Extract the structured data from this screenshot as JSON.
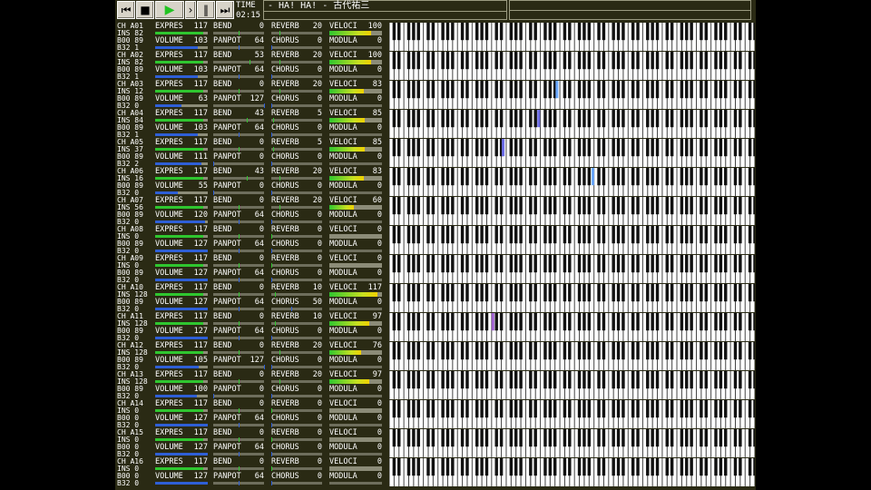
{
  "toolbar": {
    "buttons": [
      {
        "name": "rewind-to-start-button",
        "glyph": "⏮"
      },
      {
        "name": "stop-button",
        "glyph": "■"
      },
      {
        "name": "play-button",
        "glyph": "▶"
      },
      {
        "name": "next-button",
        "glyph": "›"
      },
      {
        "name": "pause-button",
        "glyph": "‖"
      },
      {
        "name": "fast-forward-button",
        "glyph": "⏭"
      }
    ],
    "time_label": "TIME",
    "time_value": "02:15"
  },
  "song_title": "- HA! HA! - 古代祐三",
  "labels": {
    "ch": "CH",
    "ins": "INS",
    "b00": "B00",
    "b32": "B32",
    "expres": "EXPRES",
    "volume": "VOLUME",
    "bend": "BEND",
    "panpot": "PANPOT",
    "reverb": "REVERB",
    "chorus": "CHORUS",
    "veloci": "VELOCI",
    "modula": "MODULA"
  },
  "colors": {
    "green_bar": "#2fc62f",
    "blue_bar": "#2f5fd6",
    "gray_bar": "#8c8c78",
    "background": "#2a2a14"
  },
  "channels": [
    {
      "ch": "A01",
      "ins": "82",
      "b00": "89",
      "b32": "1",
      "expres": 117,
      "volume": 103,
      "bend": 0,
      "panpot": 64,
      "reverb": 20,
      "chorus": 0,
      "veloci": 100,
      "modula": 0,
      "note": null
    },
    {
      "ch": "A02",
      "ins": "82",
      "b00": "89",
      "b32": "1",
      "expres": 117,
      "volume": 103,
      "bend": 53,
      "panpot": 64,
      "reverb": 20,
      "chorus": 0,
      "veloci": 100,
      "modula": 0,
      "note": null
    },
    {
      "ch": "A03",
      "ins": "12",
      "b00": "89",
      "b32": "0",
      "expres": 117,
      "volume": 63,
      "bend": 0,
      "panpot": 127,
      "reverb": 20,
      "chorus": 0,
      "veloci": 83,
      "modula": 0,
      "note": {
        "pos": 0.455,
        "color": "#6aa8ff"
      }
    },
    {
      "ch": "A04",
      "ins": "84",
      "b00": "89",
      "b32": "1",
      "expres": 117,
      "volume": 103,
      "bend": 43,
      "panpot": 64,
      "reverb": 5,
      "chorus": 0,
      "veloci": 85,
      "modula": 0,
      "note": {
        "pos": 0.405,
        "color": "#6d6de8"
      }
    },
    {
      "ch": "A05",
      "ins": "37",
      "b00": "89",
      "b32": "2",
      "expres": 117,
      "volume": 111,
      "bend": 0,
      "panpot": 0,
      "reverb": 5,
      "chorus": 0,
      "veloci": 85,
      "modula": 0,
      "note": {
        "pos": 0.308,
        "color": "#6d6de8"
      }
    },
    {
      "ch": "A06",
      "ins": "16",
      "b00": "89",
      "b32": "0",
      "expres": 117,
      "volume": 55,
      "bend": 43,
      "panpot": 0,
      "reverb": 20,
      "chorus": 0,
      "veloci": 83,
      "modula": 0,
      "note": {
        "pos": 0.553,
        "color": "#6aa8ff"
      }
    },
    {
      "ch": "A07",
      "ins": "56",
      "b00": "89",
      "b32": "0",
      "expres": 117,
      "volume": 120,
      "bend": 0,
      "panpot": 64,
      "reverb": 20,
      "chorus": 0,
      "veloci": 60,
      "modula": 0,
      "note": null
    },
    {
      "ch": "A08",
      "ins": "0",
      "b00": "89",
      "b32": "0",
      "expres": 117,
      "volume": 127,
      "bend": 0,
      "panpot": 64,
      "reverb": 0,
      "chorus": 0,
      "veloci": 0,
      "modula": 0,
      "note": null
    },
    {
      "ch": "A09",
      "ins": "0",
      "b00": "89",
      "b32": "0",
      "expres": 117,
      "volume": 127,
      "bend": 0,
      "panpot": 64,
      "reverb": 0,
      "chorus": 0,
      "veloci": 0,
      "modula": 0,
      "note": null
    },
    {
      "ch": "A10",
      "ins": "128",
      "b00": "89",
      "b32": "0",
      "expres": 117,
      "volume": 127,
      "bend": 0,
      "panpot": 64,
      "reverb": 10,
      "chorus": 50,
      "veloci": 117,
      "modula": 0,
      "note": null
    },
    {
      "ch": "A11",
      "ins": "128",
      "b00": "89",
      "b32": "0",
      "expres": 117,
      "volume": 127,
      "bend": 0,
      "panpot": 64,
      "reverb": 10,
      "chorus": 0,
      "veloci": 97,
      "modula": 0,
      "note": {
        "pos": 0.28,
        "color": "#a060d0"
      }
    },
    {
      "ch": "A12",
      "ins": "128",
      "b00": "89",
      "b32": "0",
      "expres": 117,
      "volume": 105,
      "bend": 0,
      "panpot": 127,
      "reverb": 20,
      "chorus": 0,
      "veloci": 76,
      "modula": 0,
      "note": null
    },
    {
      "ch": "A13",
      "ins": "128",
      "b00": "89",
      "b32": "0",
      "expres": 117,
      "volume": 100,
      "bend": 0,
      "panpot": 0,
      "reverb": 20,
      "chorus": 0,
      "veloci": 97,
      "modula": 0,
      "note": null
    },
    {
      "ch": "A14",
      "ins": "0",
      "b00": "0",
      "b32": "0",
      "expres": 117,
      "volume": 127,
      "bend": 0,
      "panpot": 64,
      "reverb": 0,
      "chorus": 0,
      "veloci": 0,
      "modula": 0,
      "note": null
    },
    {
      "ch": "A15",
      "ins": "0",
      "b00": "0",
      "b32": "0",
      "expres": 117,
      "volume": 127,
      "bend": 0,
      "panpot": 64,
      "reverb": 0,
      "chorus": 0,
      "veloci": 0,
      "modula": 0,
      "note": null
    },
    {
      "ch": "A16",
      "ins": "0",
      "b00": "0",
      "b32": "0",
      "expres": 117,
      "volume": 127,
      "bend": 0,
      "panpot": 64,
      "reverb": 0,
      "chorus": 0,
      "veloci": 0,
      "modula": 0,
      "note": null
    }
  ]
}
